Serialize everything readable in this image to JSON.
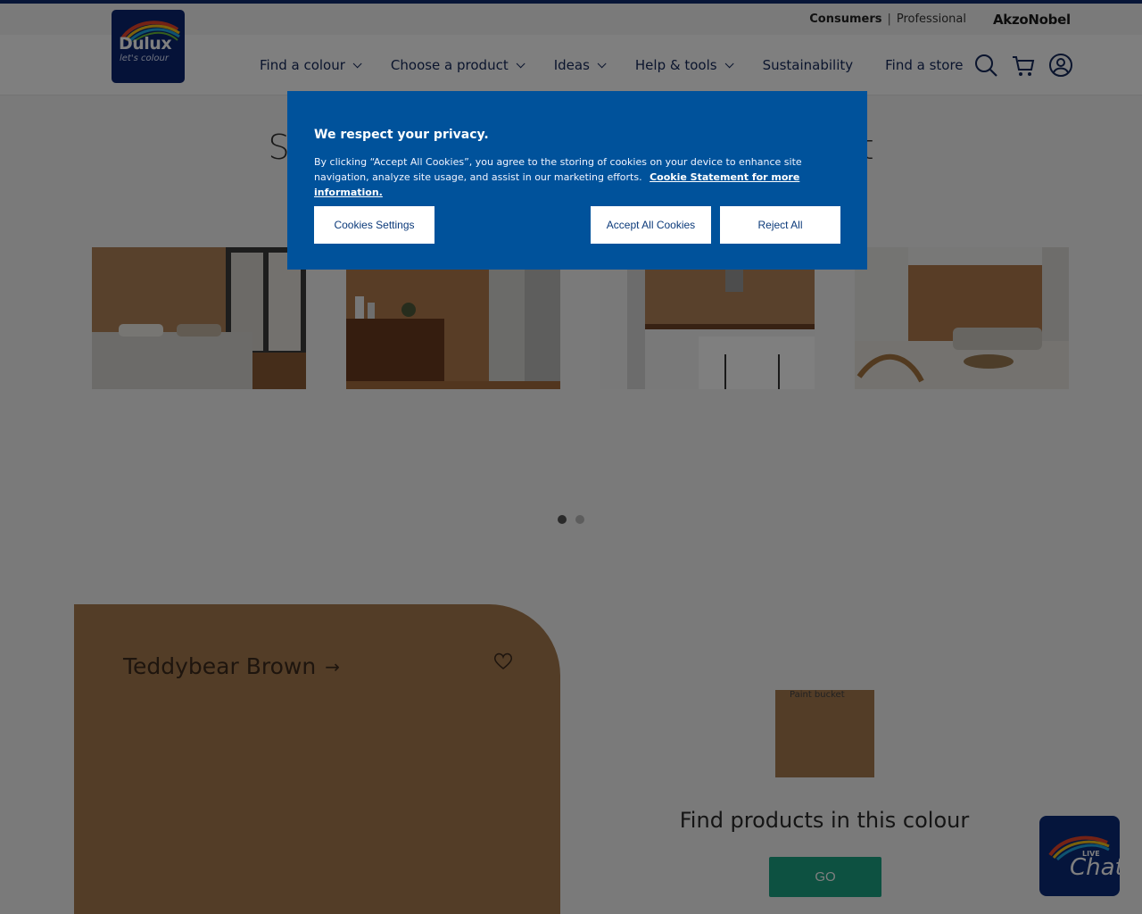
{
  "header": {
    "util": {
      "consumers": "Consumers",
      "professional": "Professional",
      "separator": "|",
      "akzo": "AkzoNobel"
    },
    "logo": {
      "brand": "Dulux",
      "tagline": "let's colour"
    },
    "nav": [
      {
        "label": "Find a colour",
        "has_dropdown": true
      },
      {
        "label": "Choose a product",
        "has_dropdown": true
      },
      {
        "label": "Ideas",
        "has_dropdown": true
      },
      {
        "label": "Help & tools",
        "has_dropdown": true
      },
      {
        "label": "Sustainability",
        "has_dropdown": false
      },
      {
        "label": "Find a store",
        "has_dropdown": false
      }
    ],
    "icons": [
      "search-icon",
      "cart-icon",
      "account-icon"
    ]
  },
  "main": {
    "headline_visible_left": "S",
    "headline_visible_right": "t",
    "carousel": {
      "page": 1,
      "pages": 2
    },
    "swatch": {
      "name": "Teddybear Brown",
      "color": "#a77a4e"
    },
    "bucket_alt": "Paint bucket",
    "find_title": "Find products in this colour",
    "go_label": "GO"
  },
  "cookie_modal": {
    "title": "We respect your privacy.",
    "body": "By clicking “Accept All Cookies”, you agree to the storing of cookies on your device to enhance site navigation, analyze site usage, and assist in our marketing efforts.",
    "link": "Cookie Statement for more information.",
    "settings_label": "Cookies Settings",
    "accept_label": "Accept All Cookies",
    "reject_label": "Reject All",
    "background": "#00529b"
  },
  "chat": {
    "live": "LIVE",
    "text": "Chat"
  }
}
